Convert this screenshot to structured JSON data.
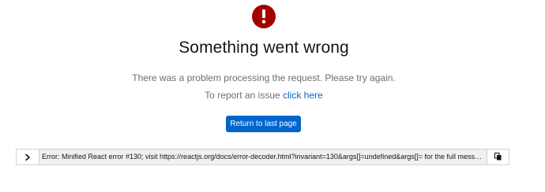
{
  "error": {
    "icon": "exclamation-circle-icon",
    "icon_color": "#a30000",
    "title": "Something went wrong",
    "message": "There was a problem processing the request. Please try again.",
    "report_prefix": "To report an issue",
    "report_link": "click here",
    "return_label": "Return to last page",
    "button_color": "#0066cc"
  },
  "details": {
    "toggle_icon": "chevron-right-icon",
    "text": "Error: Minified React error #130; visit https://reactjs.org/docs/error-decoder.html?invariant=130&args[]=undefined&args[]= for the full mess…",
    "copy_icon": "copy-icon"
  }
}
